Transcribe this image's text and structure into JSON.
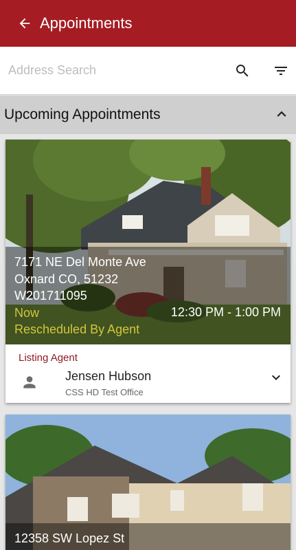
{
  "appbar": {
    "title": "Appointments",
    "back_icon": "arrow-back-icon",
    "color": "#a51c23"
  },
  "search": {
    "placeholder": "Address Search",
    "value": "",
    "search_icon": "search-icon",
    "filter_icon": "filter-icon"
  },
  "section": {
    "title": "Upcoming Appointments",
    "toggle_icon": "chevron-up-icon"
  },
  "appointments": [
    {
      "address_line1": "7171 NE Del Monte Ave",
      "address_line2": "Oxnard CO, 51232",
      "listing_id": "W201711095",
      "status": "Now",
      "time": "12:30 PM - 1:00 PM",
      "note": "Rescheduled By Agent",
      "agent_label": "Listing Agent",
      "agent_name": "Jensen Hubson",
      "agent_office": "CSS HD Test Office",
      "avatar_icon": "person-icon",
      "expand_icon": "chevron-down-icon"
    },
    {
      "address_line1": "12358 SW Lopez St"
    }
  ]
}
